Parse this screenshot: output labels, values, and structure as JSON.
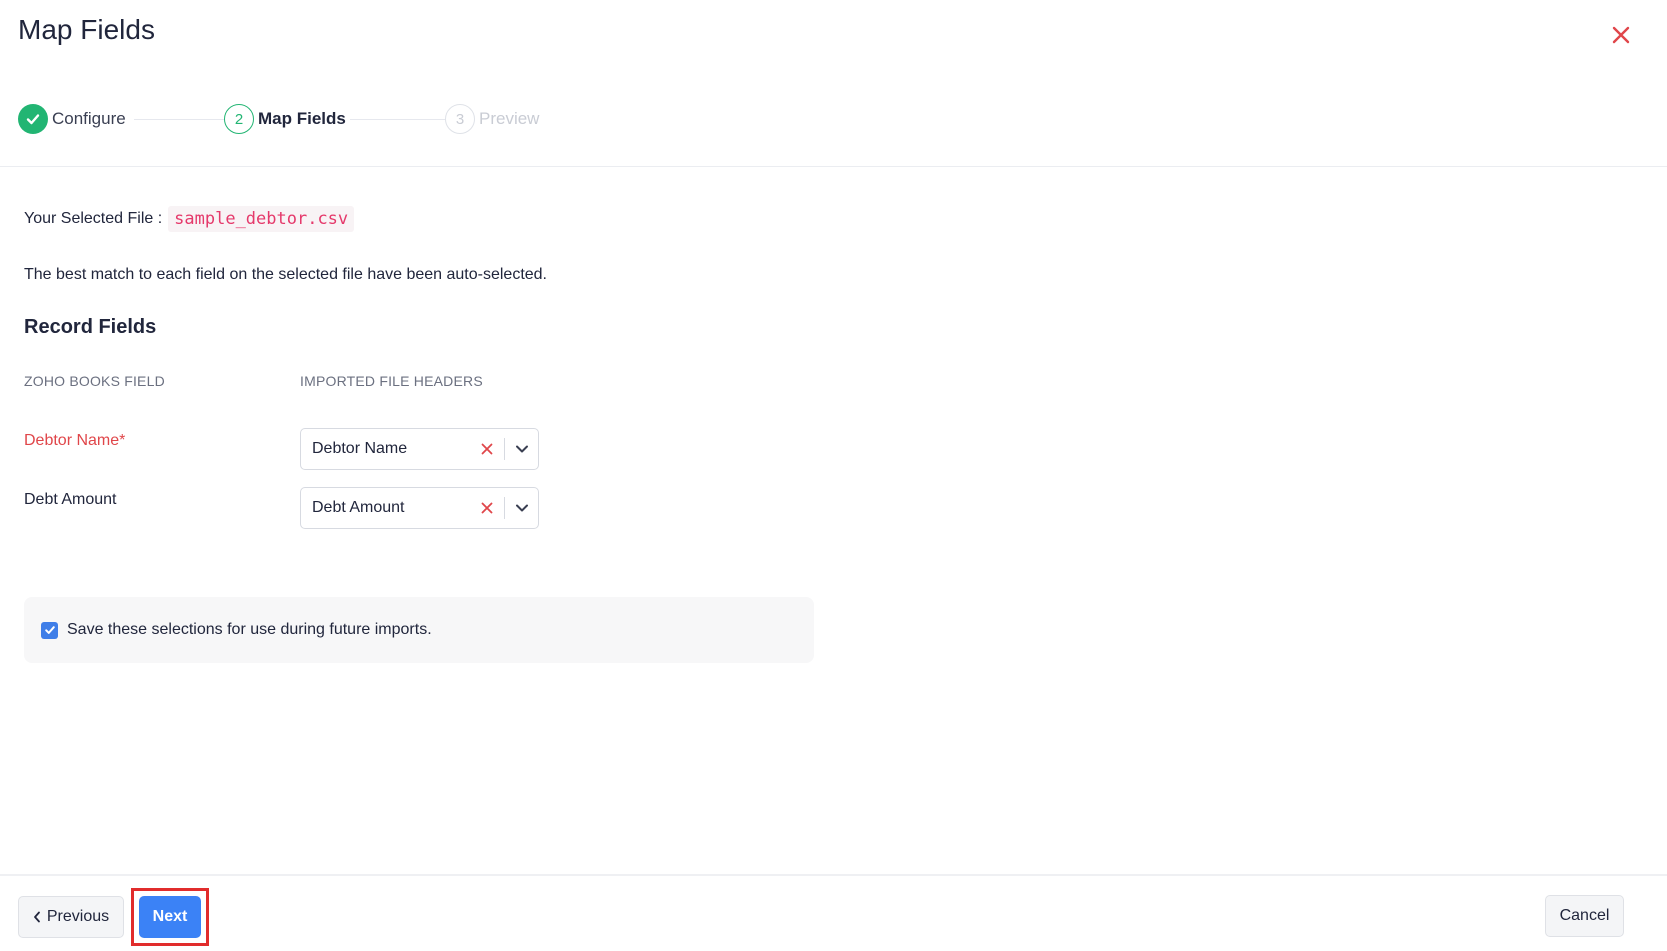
{
  "header": {
    "title": "Map Fields"
  },
  "stepper": {
    "steps": [
      {
        "number": "1",
        "label": "Configure",
        "state": "done"
      },
      {
        "number": "2",
        "label": "Map Fields",
        "state": "active"
      },
      {
        "number": "3",
        "label": "Preview",
        "state": "pending"
      }
    ]
  },
  "file": {
    "label": "Your Selected File :",
    "name": "sample_debtor.csv"
  },
  "info": {
    "text": "The best match to each field on the selected file have been auto-selected."
  },
  "section": {
    "title": "Record Fields",
    "col_zoho": "ZOHO BOOKS FIELD",
    "col_imported": "IMPORTED FILE HEADERS"
  },
  "fields": [
    {
      "label": "Debtor Name*",
      "required": true,
      "selected": "Debtor Name"
    },
    {
      "label": "Debt Amount",
      "required": false,
      "selected": "Debt Amount"
    }
  ],
  "save": {
    "checked": true,
    "text": "Save these selections for use during future imports."
  },
  "footer": {
    "previous_label": "Previous",
    "next_label": "Next",
    "cancel_label": "Cancel"
  },
  "colors": {
    "accent": "#3b82f6",
    "success": "#22b573",
    "danger": "#e0464a",
    "highlight_border": "#e12c2c"
  },
  "icons": {
    "close": "close-icon",
    "check": "check-icon",
    "clear": "clear-x-icon",
    "caret": "chevron-down-icon",
    "previous": "chevron-left-icon"
  }
}
